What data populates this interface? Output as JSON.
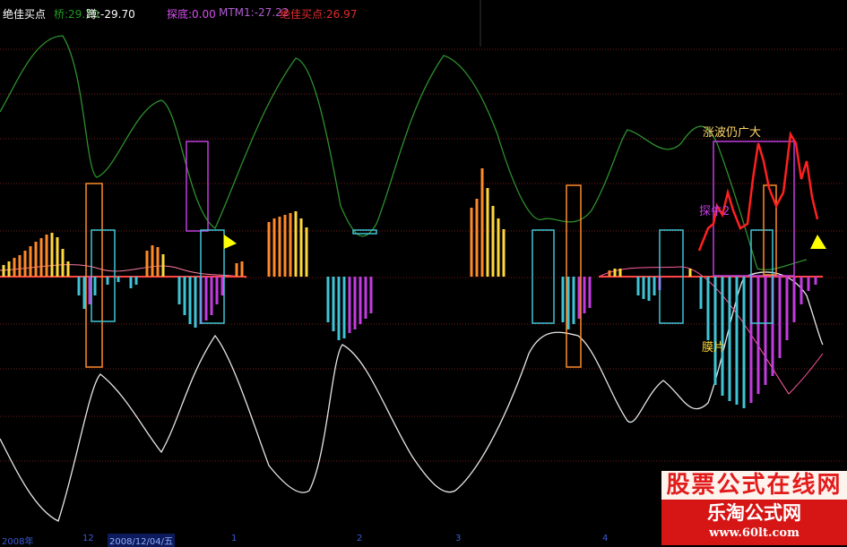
{
  "header": {
    "indicator_name": "绝佳买点",
    "items": [
      {
        "label": "桥:29.70",
        "color": "#1f9a1f"
      },
      {
        "label": "蹲:-29.70",
        "color": "#ffffff"
      },
      {
        "label": "",
        "color": "#3355ff"
      },
      {
        "label": "探底:0.00",
        "color": "#d94ff0"
      },
      {
        "label": "MTM1:-27.22",
        "color": "#b05cd0"
      },
      {
        "label": "绝佳买点:26.97",
        "color": "#e22c2c"
      }
    ]
  },
  "annotations": {
    "zhangbo": "涨波仍广大",
    "tanniu": "探牛2",
    "mopian": "膜片"
  },
  "bottom_axis": {
    "labels": [
      "2008年",
      "12",
      "2008/12/04/五",
      "1",
      "2",
      "3",
      "4"
    ]
  },
  "logo": {
    "top_text": "股票公式在线网",
    "mid_text": "乐淘公式网",
    "url": "www.60lt.com"
  },
  "colors": {
    "background": "#000000",
    "grid": "#7a1a1a",
    "green_line": "#2e8f2e",
    "white_line": "#e6e6e6",
    "red_line": "#ff2020",
    "magenta": "#c23ce0",
    "cyan": "#3fc4d6",
    "orange": "#ff8a2a",
    "yellow": "#ffd83a",
    "triangle": "#ffff00"
  }
}
